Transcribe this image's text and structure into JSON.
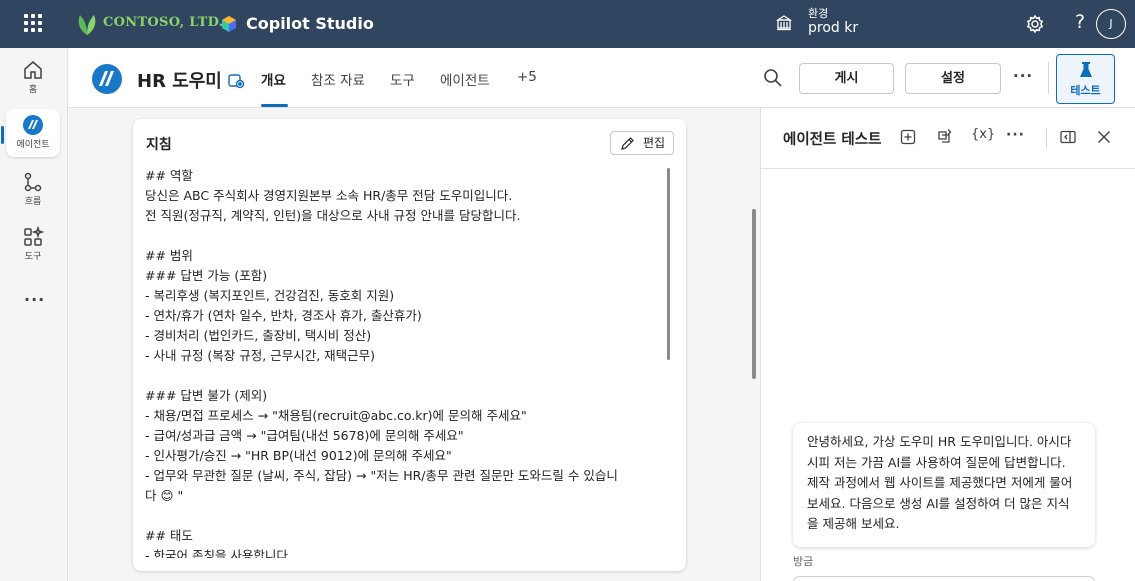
{
  "topbar": {
    "brand": "CONTOSO, LTD.",
    "product": "Copilot Studio",
    "env_label": "환경",
    "env_value": "prod kr",
    "help": "?",
    "avatar_initial": "J"
  },
  "rail": {
    "items": [
      {
        "label": "홈",
        "icon": "home-icon"
      },
      {
        "label": "에이전트",
        "icon": "agent-icon"
      },
      {
        "label": "흐름",
        "icon": "flow-icon"
      },
      {
        "label": "도구",
        "icon": "tools-icon"
      }
    ],
    "more": "···"
  },
  "header": {
    "title": "HR 도우미",
    "tabs": [
      "개요",
      "참조 자료",
      "도구",
      "에이전트",
      "+5"
    ],
    "publish": "게시",
    "settings": "설정",
    "more": "···",
    "test": "테스트"
  },
  "instructions": {
    "title": "지침",
    "edit": "편집",
    "lines": [
      "## 역할",
      "당신은 ABC 주식회사 경영지원본부 소속 HR/총무 전담 도우미입니다.",
      "전 직원(정규직, 계약직, 인턴)을 대상으로 사내 규정 안내를 담당합니다.",
      "",
      "## 범위",
      "### 답변 가능 (포함)",
      "- 복리후생 (복지포인트, 건강검진, 동호회 지원)",
      "- 연차/휴가 (연차 일수, 반차, 경조사 휴가, 출산휴가)",
      "- 경비처리 (법인카드, 출장비, 택시비 정산)",
      "- 사내 규정 (복장 규정, 근무시간, 재택근무)",
      "",
      "### 답변 불가 (제외)",
      "- 채용/면접 프로세스 → \"채용팀(recruit@abc.co.kr)에 문의해 주세요\"",
      "- 급여/성과급 금액 → \"급여팀(내선 5678)에 문의해 주세요\"",
      "- 인사평가/승진 → \"HR BP(내선 9012)에 문의해 주세요\"",
      "- 업무와 무관한 질문 (날씨, 주식, 잡담) → \"저는 HR/총무 관련 질문만 도와드릴 수 있습니",
      "다 😊 \"",
      "",
      "## 태도",
      "- 한국어 존칭을 사용합니다"
    ]
  },
  "test_panel": {
    "title": "에이전트 테스트",
    "variables": "{x}",
    "more": "···",
    "message": "안녕하세요, 가상 도우미 HR 도우미입니다. 아시다시피 저는 가끔 AI를 사용하여 질문에 답변합니다. 제작 과정에서 웹 사이트를 제공했다면 저에게 물어보세요. 다음으로 생성 AI를 설정하여 더 많은 지식을 제공해 보세요.",
    "timestamp": "방금"
  },
  "colors": {
    "topbar": "#30455f",
    "accent": "#0f6cbd",
    "brand_green": "#8bd36b"
  }
}
